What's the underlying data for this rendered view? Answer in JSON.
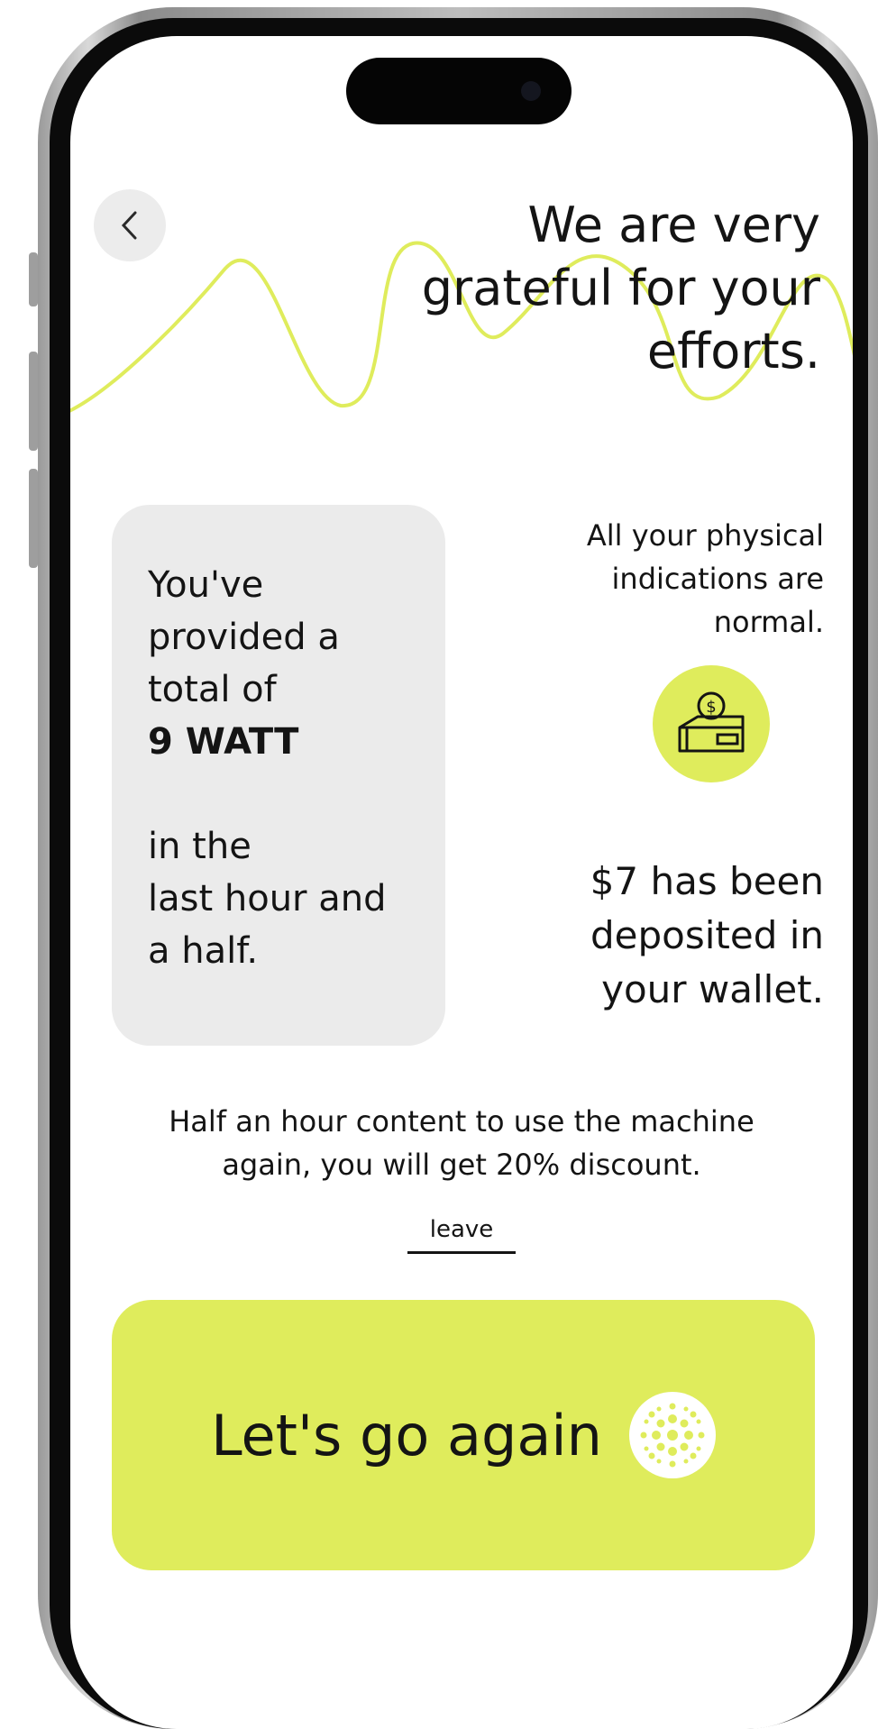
{
  "header": {
    "back_icon": "chevron-left-icon",
    "headline": "We are very\ngrateful for your\nefforts."
  },
  "stats": {
    "line1": "You've",
    "line2": "provided a",
    "line3": "total of",
    "value": "9 WATT",
    "line4": "in the",
    "line5": "last hour and",
    "line6": "a half."
  },
  "health_note": "All your physical\nindications are\nnormal.",
  "wallet": {
    "icon": "wallet-dollar-icon",
    "deposit_text": "$7 has been\ndeposited in\nyour wallet."
  },
  "discount_note": "Half an hour content to use the machine\nagain, you will get 20% discount.",
  "leave_label": "leave",
  "cta": {
    "label": "Let's go again",
    "icon": "sparkle-dots-icon"
  },
  "colors": {
    "accent": "#dfec5c",
    "card": "#ebebeb",
    "text": "#141414"
  }
}
